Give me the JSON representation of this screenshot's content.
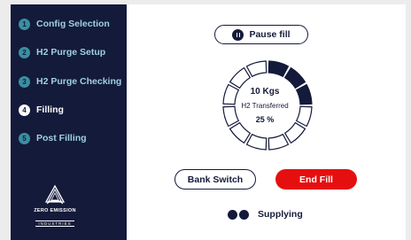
{
  "sidebar": {
    "steps": [
      {
        "num": "1",
        "label": "Config Selection"
      },
      {
        "num": "2",
        "label": "H2 Purge Setup"
      },
      {
        "num": "3",
        "label": "H2 Purge Checking"
      },
      {
        "num": "4",
        "label": "Filling"
      },
      {
        "num": "5",
        "label": "Post Filling"
      }
    ],
    "active_step": 4
  },
  "logo": {
    "name": "ZERO EMISSION",
    "subtitle": "INDUSTRIES"
  },
  "controls": {
    "pause_label": "Pause fill",
    "bank_switch_label": "Bank Switch",
    "end_fill_label": "End Fill"
  },
  "gauge": {
    "amount": "10 Kgs",
    "caption": "H2 Transferred",
    "percent_label": "25 %",
    "progress": 0.25,
    "segment_count": 12
  },
  "status": {
    "label": "Supplying"
  },
  "colors": {
    "navy": "#141a3a",
    "accent_teal": "#3a8fa0",
    "end_fill_red": "#e60f0f",
    "segment_empty": "#ffffff"
  }
}
